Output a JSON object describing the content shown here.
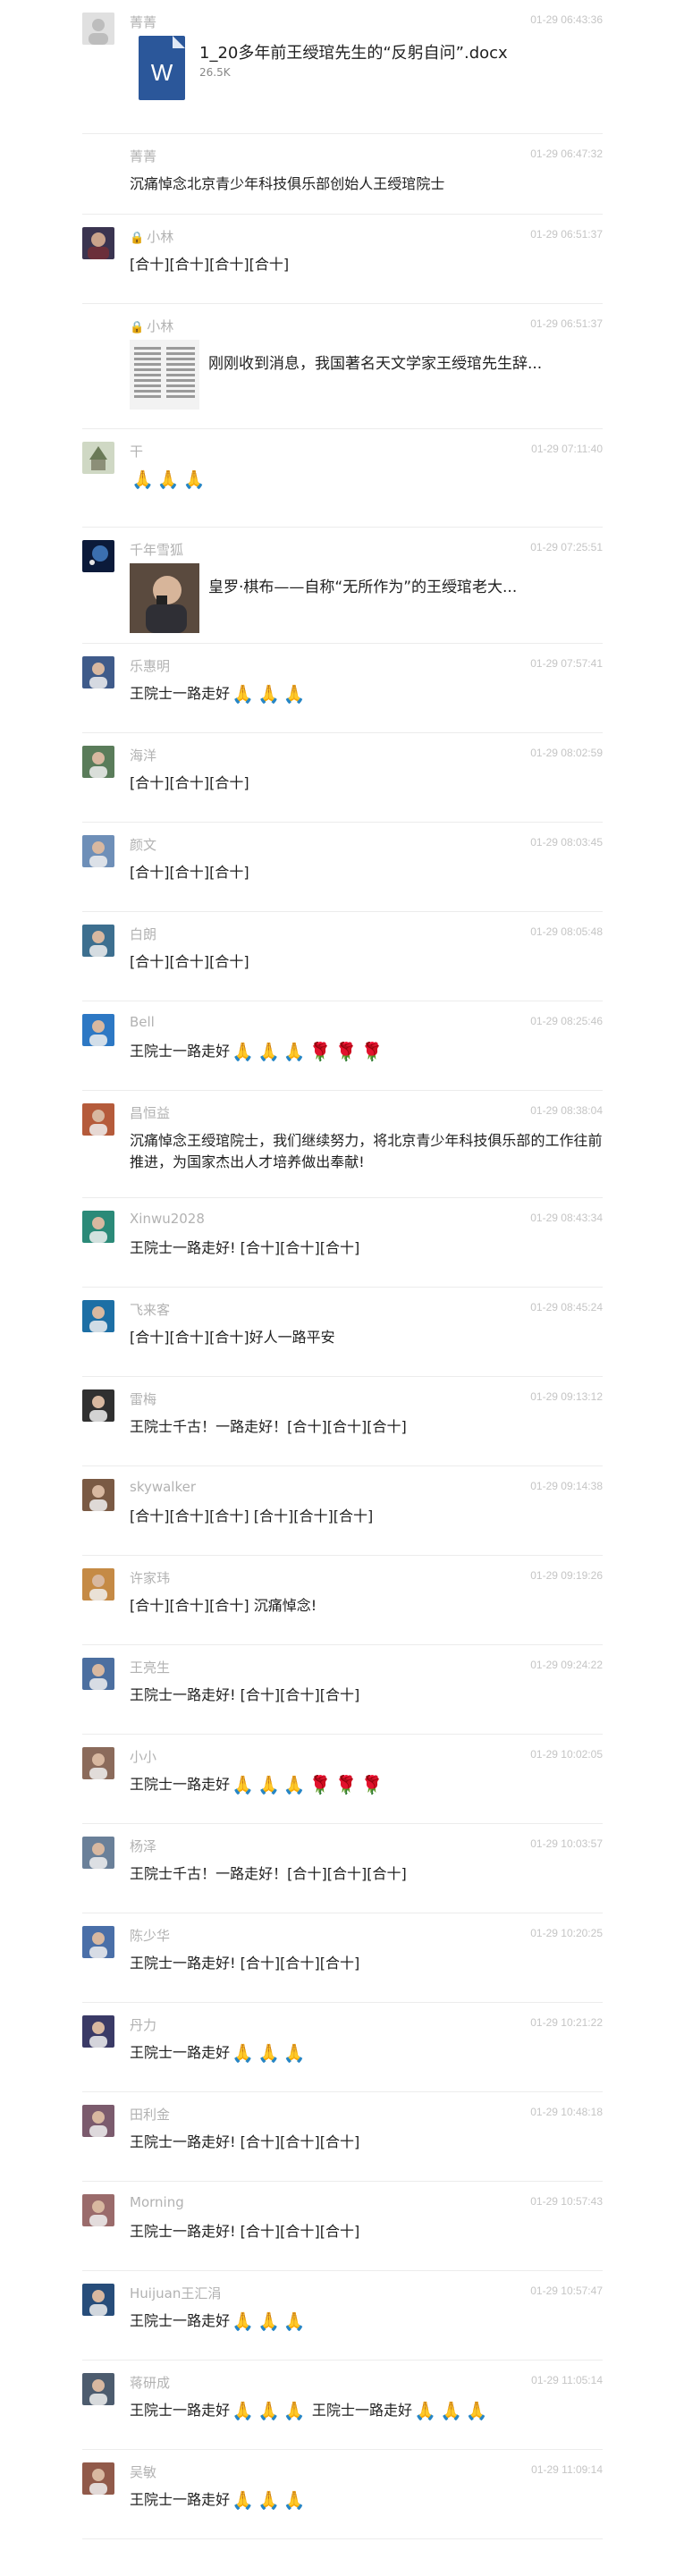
{
  "messages": [
    {
      "id": "m0",
      "name": "菁菁",
      "time": "01-29 06:43:36",
      "type": "file",
      "file_name": "1_20多年前王绶琯先生的“反躬自问”.docx",
      "file_size": "26.5K",
      "file_icon": "word-icon"
    },
    {
      "id": "m1",
      "name": "菁菁",
      "time": "01-29 06:47:32",
      "type": "text",
      "text": "沉痛悼念北京青少年科技俱乐部创始人王绶琯院士"
    },
    {
      "id": "m2",
      "name": "小林",
      "time": "01-29 06:51:37",
      "type": "text",
      "text": "[合十][合十][合十][合十]"
    },
    {
      "id": "m3",
      "name": "小林",
      "time": "01-29 06:51:37",
      "type": "link",
      "link_title": "刚刚收到消息，我国著名天文学家王绶琯先生辞..."
    },
    {
      "id": "m4",
      "name": "干",
      "time": "01-29 07:11:40",
      "type": "emoji",
      "emoji": "🙏🙏🙏"
    },
    {
      "id": "m5",
      "name": "千年雪狐",
      "time": "01-29 07:25:51",
      "type": "link",
      "link_title": "皇罗·棋布——自称“无所作为”的王绶琯老大..."
    },
    {
      "id": "m6",
      "name": "乐惠明",
      "time": "01-29 07:57:41",
      "type": "text",
      "text": "王院士一路走好🙏🙏🙏"
    },
    {
      "id": "m7",
      "name": "海洋",
      "time": "01-29 08:02:59",
      "type": "text",
      "text": "[合十][合十][合十]"
    },
    {
      "id": "m8",
      "name": "颜文",
      "time": "01-29 08:03:45",
      "type": "text",
      "text": "[合十][合十][合十]"
    },
    {
      "id": "m9",
      "name": "白朗",
      "time": "01-29 08:05:48",
      "type": "text",
      "text": "[合十][合十][合十]"
    },
    {
      "id": "m10",
      "name": "Bell",
      "time": "01-29 08:25:46",
      "type": "text",
      "text": "王院士一路走好🙏🙏🙏🌹🌹🌹"
    },
    {
      "id": "m11",
      "name": "昌恒益",
      "time": "01-29 08:38:04",
      "type": "text",
      "text": "沉痛悼念王绶琯院士，我们继续努力，将北京青少年科技俱乐部的工作往前推进，为国家杰出人才培养做出奉献!"
    },
    {
      "id": "m12",
      "name": "Xinwu2028",
      "time": "01-29 08:43:34",
      "type": "text",
      "text": "王院士一路走好! [合十][合十][合十]"
    },
    {
      "id": "m13",
      "name": "飞来客",
      "time": "01-29 08:45:24",
      "type": "text",
      "text": "[合十][合十][合十]好人一路平安"
    },
    {
      "id": "m14",
      "name": "雷梅",
      "time": "01-29 09:13:12",
      "type": "text",
      "text": "王院士千古！一路走好！[合十][合十][合十]"
    },
    {
      "id": "m15",
      "name": "skywalker",
      "time": "01-29 09:14:38",
      "type": "text",
      "text": "[合十][合十][合十] [合十][合十][合十]"
    },
    {
      "id": "m16",
      "name": "许家玮",
      "time": "01-29 09:19:26",
      "type": "text",
      "text": "[合十][合十][合十] 沉痛悼念!"
    },
    {
      "id": "m17",
      "name": "王亮生",
      "time": "01-29 09:24:22",
      "type": "text",
      "text": "王院士一路走好! [合十][合十][合十]"
    },
    {
      "id": "m18",
      "name": "小小",
      "time": "01-29 10:02:05",
      "type": "text",
      "text": "王院士一路走好🙏🙏🙏🌹🌹🌹"
    },
    {
      "id": "m19",
      "name": "杨泽",
      "time": "01-29 10:03:57",
      "type": "text",
      "text": "王院士千古！一路走好！[合十][合十][合十]"
    },
    {
      "id": "m20",
      "name": "陈少华",
      "time": "01-29 10:20:25",
      "type": "text",
      "text": "王院士一路走好! [合十][合十][合十]"
    },
    {
      "id": "m21",
      "name": "丹力",
      "time": "01-29 10:21:22",
      "type": "text",
      "text": "王院士一路走好🙏🙏🙏"
    },
    {
      "id": "m22",
      "name": "田利金",
      "time": "01-29 10:48:18",
      "type": "text",
      "text": "王院士一路走好! [合十][合十][合十]"
    },
    {
      "id": "m23",
      "name": "Morning",
      "time": "01-29 10:57:43",
      "type": "text",
      "text": "王院士一路走好! [合十][合十][合十]"
    },
    {
      "id": "m24",
      "name": "Huijuan王汇涓",
      "time": "01-29 10:57:47",
      "type": "text",
      "text": "王院士一路走好🙏🙏🙏"
    },
    {
      "id": "m25",
      "name": "蒋研成",
      "time": "01-29 11:05:14",
      "type": "text",
      "text": "王院士一路走好🙏🙏🙏 王院士一路走好🙏🙏🙏"
    },
    {
      "id": "m26",
      "name": "吴敏",
      "time": "01-29 11:09:14",
      "type": "text",
      "text": "王院士一路走好🙏🙏🙏"
    }
  ]
}
